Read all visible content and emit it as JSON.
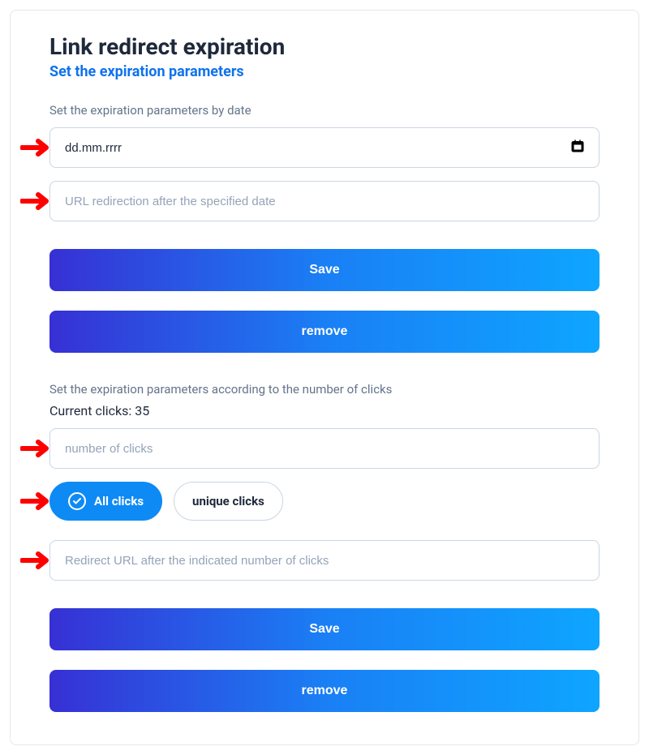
{
  "header": {
    "title": "Link redirect expiration",
    "subtitle": "Set the expiration parameters"
  },
  "dateSection": {
    "label": "Set the expiration parameters by date",
    "dateValue": "dd.mm.rrrr",
    "urlPlaceholder": "URL redirection after the specified date",
    "saveLabel": "Save",
    "removeLabel": "remove"
  },
  "clicksSection": {
    "label": "Set the expiration parameters according to the number of clicks",
    "currentClicksLabel": "Current clicks:",
    "currentClicksValue": "35",
    "numberPlaceholder": "number of clicks",
    "allClicksLabel": "All clicks",
    "uniqueClicksLabel": "unique clicks",
    "redirectPlaceholder": "Redirect URL after the indicated number of clicks",
    "saveLabel": "Save",
    "removeLabel": "remove"
  },
  "colors": {
    "accent": "#0e72ed",
    "arrow": "#ff0000"
  }
}
